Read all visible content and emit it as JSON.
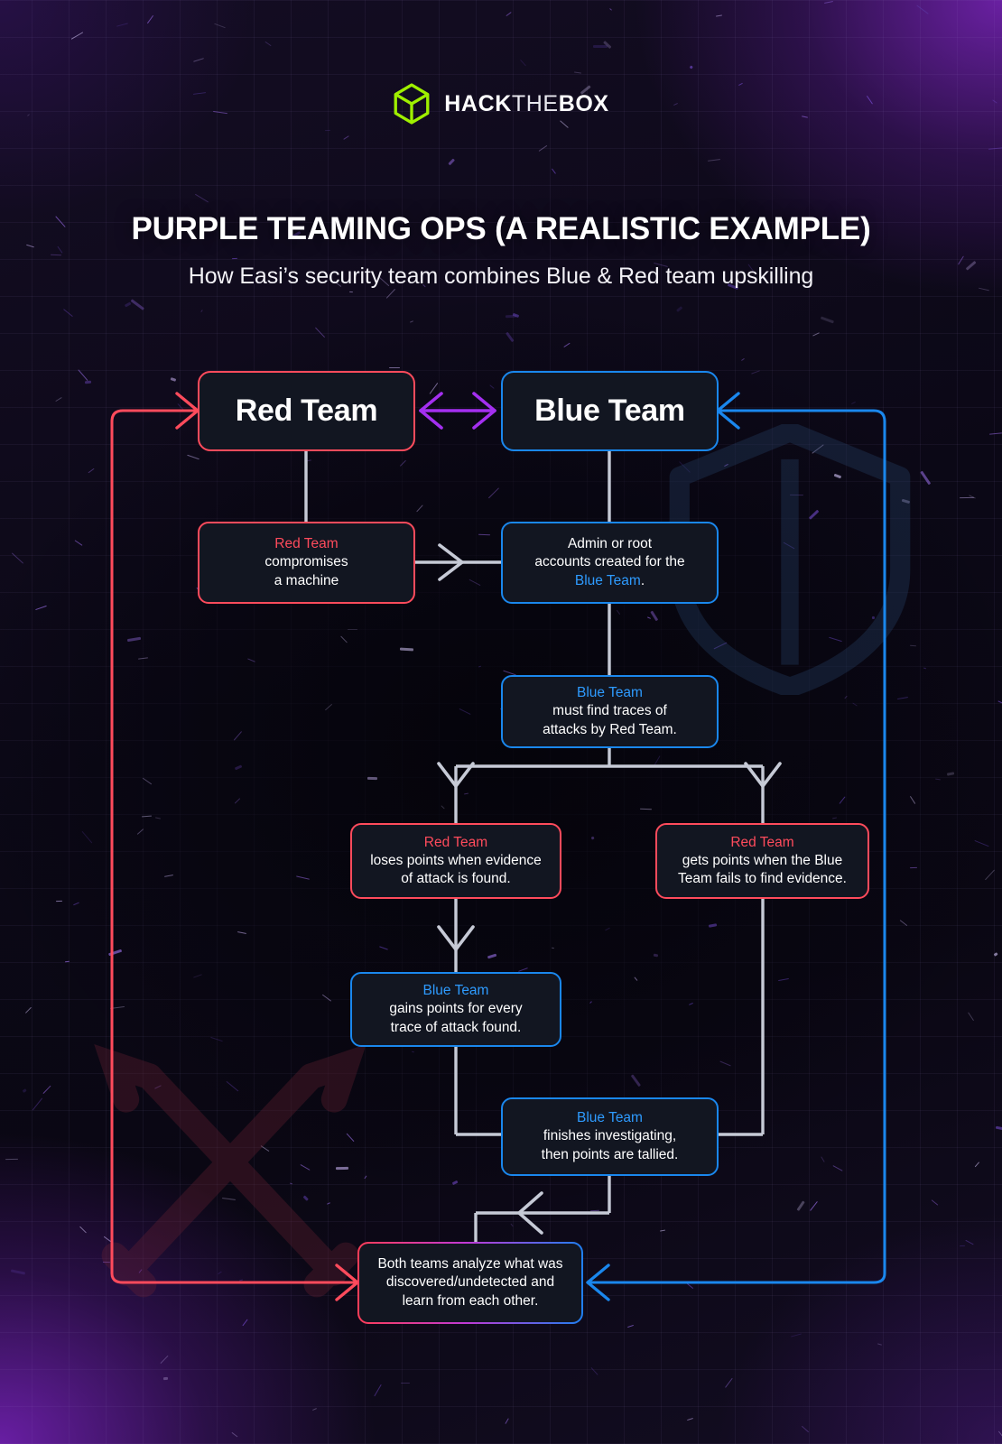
{
  "brand": {
    "logo_icon": "hackthebox-cube-icon",
    "name_bold": "HACK",
    "name_thin": "THE",
    "name_bold2": "BOX"
  },
  "header": {
    "title": "PURPLE TEAMING OPS (A REALISTIC EXAMPLE)",
    "subtitle": "How Easi’s security team combines Blue & Red team upskilling"
  },
  "colors": {
    "red": "#ff4b5c",
    "blue": "#1a87ed",
    "blue_text": "#2e9bff",
    "purple": "#a42ff0",
    "wire_gray": "#c6cad6",
    "node_fill": "#121621",
    "brand_green": "#9fef00"
  },
  "watermarks": {
    "shield": "shield-watermark-icon",
    "swords": "crossed-swords-watermark-icon"
  },
  "nodes": {
    "red_team_header": {
      "label": "Red Team"
    },
    "blue_team_header": {
      "label": "Blue Team"
    },
    "red_compromise": {
      "accent": "Red Team",
      "body_line1": "compromises",
      "body_line2": "a machine"
    },
    "admin_accounts": {
      "body_line1": "Admin or root",
      "body_line2": "accounts created for the",
      "accent": "Blue Team",
      "tail": "."
    },
    "blue_find_traces": {
      "accent": "Blue Team",
      "body_line1": "must find traces of",
      "body_line2": "attacks by Red Team."
    },
    "red_loses_points": {
      "accent": "Red Team",
      "body_line1": "loses points when evidence",
      "body_line2": "of attack is found."
    },
    "red_gets_points": {
      "accent": "Red Team",
      "body_line1": "gets points when the Blue",
      "body_line2": "Team fails to find evidence."
    },
    "blue_gains_points": {
      "accent": "Blue Team",
      "body_line1": "gains points for every",
      "body_line2": "trace of attack found."
    },
    "blue_finishes": {
      "accent": "Blue Team",
      "body_line1": "finishes investigating,",
      "body_line2": "then points are tallied."
    },
    "both_teams_analyze": {
      "body_line1": "Both teams analyze what was",
      "body_line2": "discovered/undetected and",
      "body_line3": "learn from each other."
    }
  },
  "connectors": [
    {
      "name": "red-team-to-blue-team-bidirectional",
      "color": "#a42ff0"
    },
    {
      "name": "red-team-down-to-compromise",
      "color": "#c6cad6"
    },
    {
      "name": "compromise-to-admin-accounts",
      "color": "#c6cad6"
    },
    {
      "name": "blue-team-down-to-admin-accounts",
      "color": "#c6cad6"
    },
    {
      "name": "admin-accounts-to-find-traces",
      "color": "#c6cad6"
    },
    {
      "name": "find-traces-to-red-loses-points",
      "color": "#c6cad6"
    },
    {
      "name": "find-traces-to-red-gets-points",
      "color": "#c6cad6"
    },
    {
      "name": "red-loses-points-to-blue-gains-points",
      "color": "#c6cad6"
    },
    {
      "name": "blue-gains-points-to-blue-finishes",
      "color": "#c6cad6"
    },
    {
      "name": "red-gets-points-to-blue-finishes",
      "color": "#c6cad6"
    },
    {
      "name": "blue-finishes-to-both-teams-analyze",
      "color": "#c6cad6"
    },
    {
      "name": "both-teams-analyze-loop-to-red-team",
      "color": "#ff4b5c"
    },
    {
      "name": "both-teams-analyze-loop-to-blue-team",
      "color": "#1a87ed"
    }
  ]
}
